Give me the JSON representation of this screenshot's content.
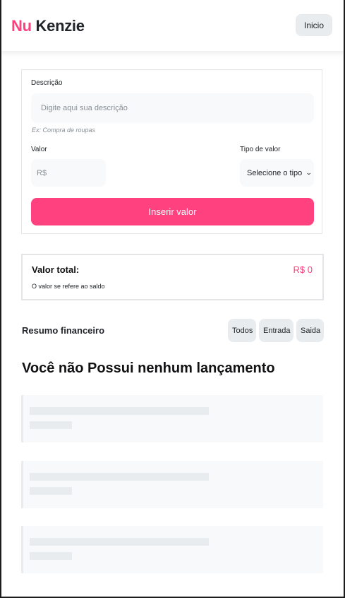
{
  "header": {
    "logo_nu": "Nu",
    "logo_kenzie": "Kenzie",
    "inicio_label": "Inicio"
  },
  "form": {
    "descricao_label": "Descrição",
    "descricao_placeholder": "Digite aqui sua descrição",
    "descricao_hint": "Ex: Compra de roupas",
    "valor_label": "Valor",
    "valor_placeholder": "R$",
    "tipo_label": "Tipo de valor",
    "tipo_selected": "Selecione o tipo",
    "insert_label": "Inserir valor"
  },
  "total": {
    "title": "Valor total:",
    "value": "R$ 0",
    "subtitle": "O valor se refere ao saldo"
  },
  "resumo": {
    "title": "Resumo financeiro",
    "filters": [
      "Todos",
      "Entrada",
      "Saida"
    ]
  },
  "empty": {
    "title": "Você não Possui nenhum lançamento"
  },
  "colors": {
    "accent": "#FF427F",
    "button_gray": "#E9ECEF",
    "field_bg": "#F8F9FA",
    "text_dark": "#212529",
    "text_muted": "#868E96"
  },
  "icons": {
    "select_chevron": "chevron-down-icon"
  }
}
